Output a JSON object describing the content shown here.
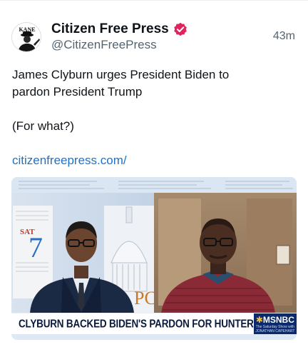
{
  "post": {
    "author_name": "Citizen Free Press",
    "author_handle": "@CitizenFreePress",
    "timestamp": "43m",
    "avatar_text": "KANE",
    "verified_icon": "verified-badge-icon",
    "text_line_1": "James Clyburn urges President Biden to",
    "text_line_2": "pardon President Trump",
    "text_line_3": "(For what?)",
    "link": "citizenfreepress.com/"
  },
  "media": {
    "chyron": "CLYBURN BACKED BIDEN'S PARDON FOR HUNTER",
    "network": "MSNBC",
    "show_line_1": "The Saturday Show with",
    "show_line_2": "JONATHAN CAPEHART",
    "calendar_day": "SAT",
    "calendar_date": "7"
  },
  "colors": {
    "verified": "#e0245e",
    "link": "#1d72c9",
    "chyron_bg": "#ffffff",
    "network_bg": "#0b2a6b"
  }
}
